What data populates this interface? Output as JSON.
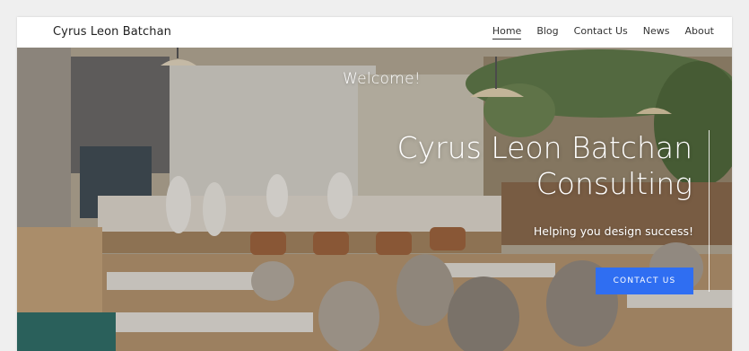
{
  "header": {
    "site_title": "Cyrus Leon Batchan",
    "nav": [
      {
        "label": "Home",
        "active": true
      },
      {
        "label": "Blog",
        "active": false
      },
      {
        "label": "Contact Us",
        "active": false
      },
      {
        "label": "News",
        "active": false
      },
      {
        "label": "About",
        "active": false
      }
    ]
  },
  "hero": {
    "welcome": "Welcome!",
    "headline_line1": "Cyrus Leon Batchan",
    "headline_line2": "Consulting",
    "tagline": "Helping you design success!",
    "cta_label": "CONTACT US",
    "background_image": "restaurant-interior-photo"
  },
  "colors": {
    "accent": "#2f6ef2",
    "header_bg": "#ffffff",
    "text_dark": "#222222"
  }
}
